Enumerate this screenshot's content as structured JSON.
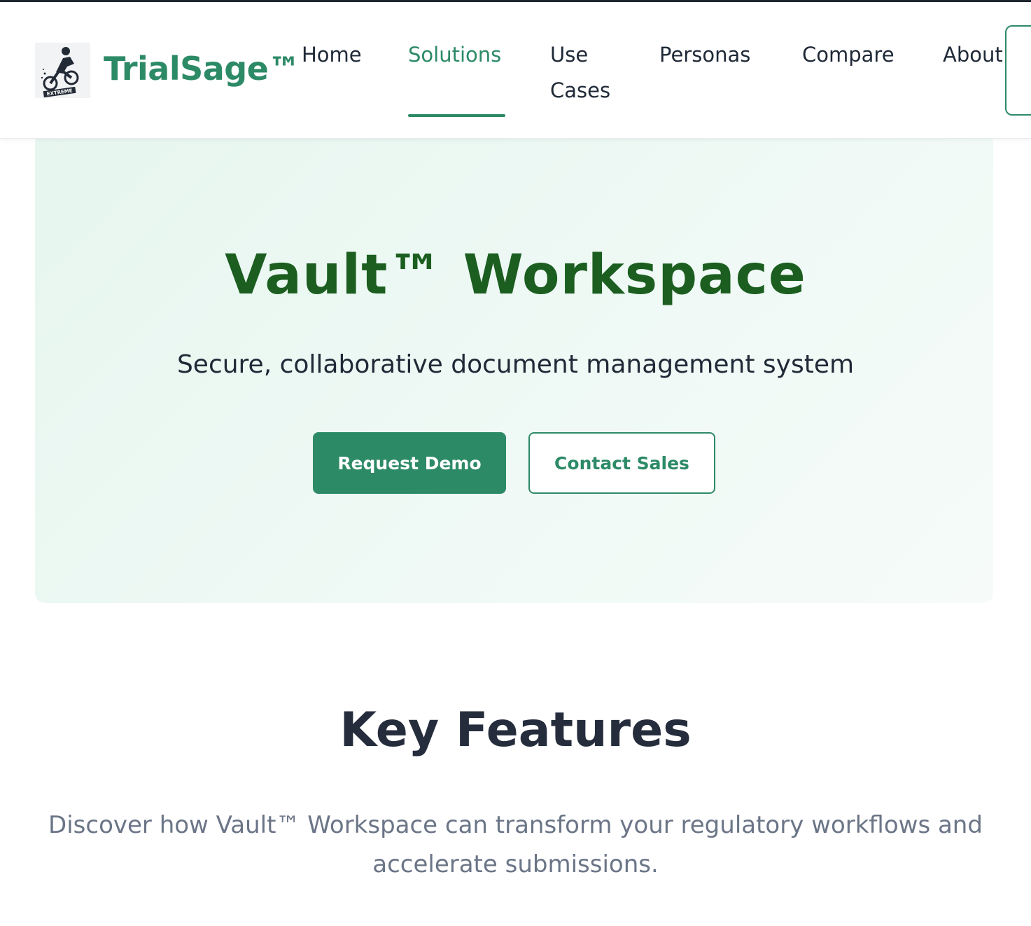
{
  "brand": {
    "name": "TrialSage™",
    "logo_text": "EXTREME",
    "logo_icon": "motocross-rider-icon",
    "accent_color": "#2d8a67"
  },
  "nav": {
    "items": [
      {
        "label": "Home",
        "active": false
      },
      {
        "label": "Solutions",
        "active": true
      },
      {
        "label": "Use Cases",
        "line1": "Use",
        "line2": "Cases",
        "active": false
      },
      {
        "label": "Personas",
        "active": false
      },
      {
        "label": "Compare",
        "active": false
      },
      {
        "label": "About",
        "active": false
      }
    ]
  },
  "hero": {
    "title": "Vault™ Workspace",
    "subtitle": "Secure, collaborative document management system",
    "primary_button": "Request Demo",
    "secondary_button": "Contact Sales",
    "title_color": "#1b5e20"
  },
  "features": {
    "title": "Key Features",
    "description": "Discover how Vault™ Workspace can transform your regulatory workflows and accelerate submissions."
  }
}
